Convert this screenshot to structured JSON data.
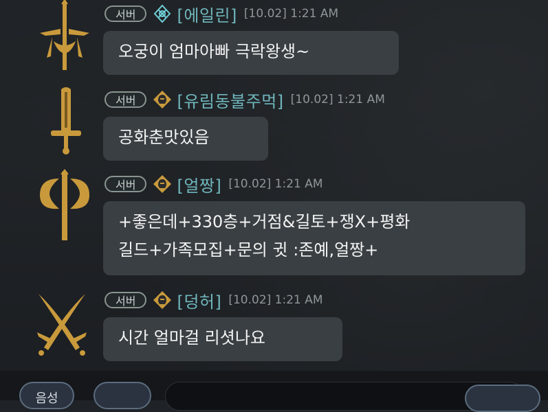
{
  "messages": [
    {
      "badge": "서버",
      "name": "[에일린]",
      "time": "[10.02] 1:21 AM",
      "lines": [
        "오궁이 엄마아빠 극락왕생~"
      ],
      "avatar_icon": "cross-sword-emblem-icon",
      "rank_icon": "cyan-crest-icon"
    },
    {
      "badge": "서버",
      "name": "[유림동불주먹]",
      "time": "[10.02] 1:21 AM",
      "lines": [
        "공화춘맛있음"
      ],
      "avatar_icon": "greatsword-icon",
      "rank_icon": "gold-helmet-icon"
    },
    {
      "badge": "서버",
      "name": "[얼짱]",
      "time": "[10.02] 1:21 AM",
      "lines": [
        "+좋은데+330층+거점&길토+쟁X+평화",
        "길드+가족모집+문의 귓 :존예,얼짱+"
      ],
      "avatar_icon": "double-axe-icon",
      "rank_icon": "gold-helmet-icon"
    },
    {
      "badge": "서버",
      "name": "[덩허]",
      "time": "[10.02] 1:21 AM",
      "lines": [
        "시간 얼마걸 리셧나요"
      ],
      "avatar_icon": "crossed-daggers-icon",
      "rank_icon": "gold-helmet-icon"
    }
  ],
  "bottom": {
    "left_button_label": "음성"
  },
  "colors": {
    "name": "#6fb7bd",
    "time": "#8f979a",
    "bubble": "#3a3f44",
    "gold": "#c99a3c",
    "badge_border": "#8a9590"
  }
}
